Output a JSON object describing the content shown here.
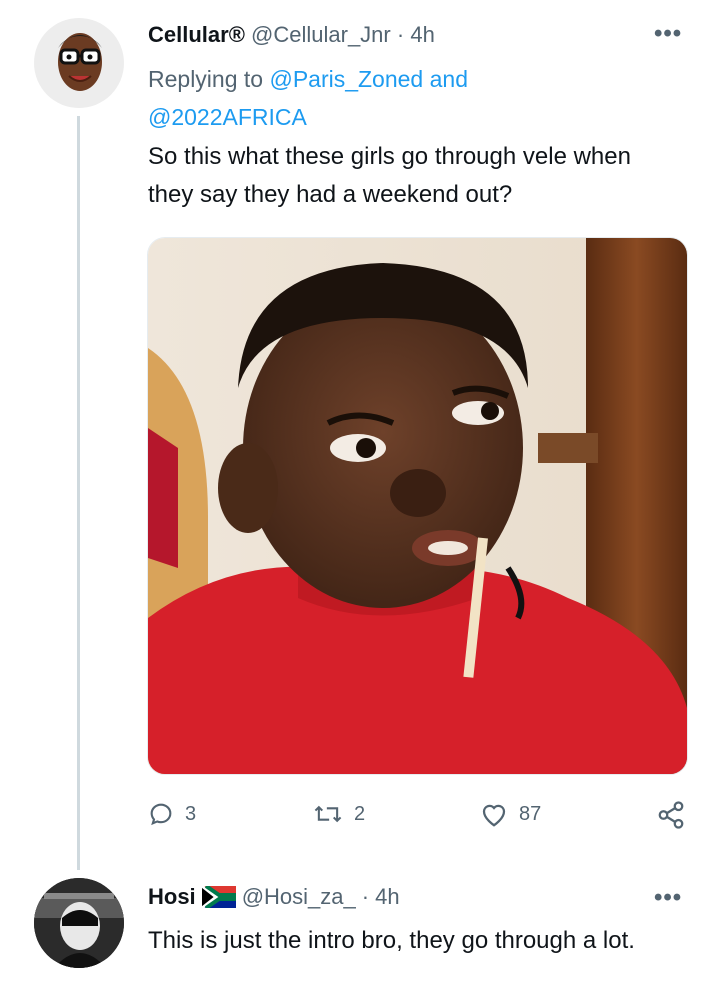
{
  "tweet": {
    "display_name": "Cellular®",
    "handle": "@Cellular_Jnr",
    "separator": "·",
    "time": "4h",
    "replying_prefix": "Replying to",
    "reply_to_1": "@Paris_Zoned",
    "reply_and": "and",
    "reply_to_2": "@2022AFRICA",
    "text": "So this what these girls go through vele when they say they had a weekend out?",
    "more_label": "•••",
    "media_icon": "meme-photo-boy-red-sweater",
    "reply_count": "3",
    "retweet_count": "2",
    "like_count": "87",
    "icons": {
      "reply": "reply-icon",
      "retweet": "retweet-icon",
      "like": "heart-icon",
      "share": "share-icon"
    }
  },
  "reply": {
    "display_name": "Hosi",
    "flag_icon": "south-africa-flag-icon",
    "handle": "@Hosi_za_",
    "separator": "·",
    "time": "4h",
    "text": "This is just the intro bro, they go through a lot.",
    "more_label": "•••"
  },
  "colors": {
    "text": "#0f1419",
    "muted": "#536471",
    "link": "#1d9bf0",
    "thread_line": "#cfd9de"
  }
}
